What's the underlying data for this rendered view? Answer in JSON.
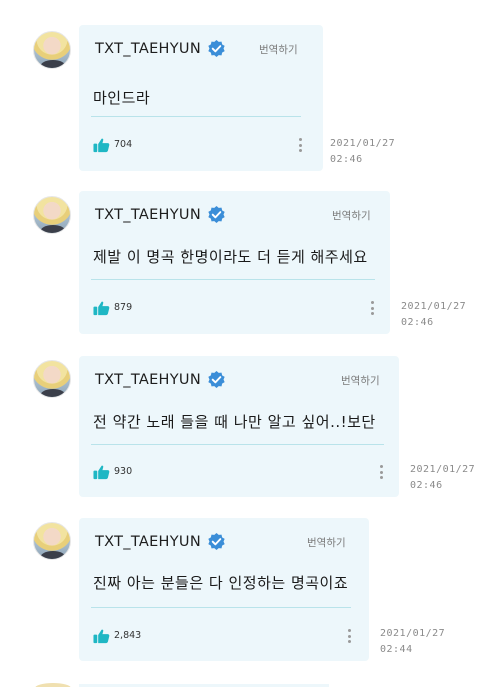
{
  "colors": {
    "bubble": "#edf7fb",
    "divider": "#b9e3ea",
    "accent": "#1fb7c4",
    "verified": "#3b8ed8"
  },
  "comments": [
    {
      "username": "TXT_TAEHYUN",
      "translate": "번역하기",
      "message": "마인드라",
      "likes": "704",
      "date": "2021/01/27",
      "time": "02:46"
    },
    {
      "username": "TXT_TAEHYUN",
      "translate": "번역하기",
      "message": "제발 이 명곡 한명이라도 더 듣게 해주세요",
      "likes": "879",
      "date": "2021/01/27",
      "time": "02:46"
    },
    {
      "username": "TXT_TAEHYUN",
      "translate": "번역하기",
      "message": "전 약간 노래 들을 때 나만 알고 싶어..!보단",
      "likes": "930",
      "date": "2021/01/27",
      "time": "02:46"
    },
    {
      "username": "TXT_TAEHYUN",
      "translate": "번역하기",
      "message": "진짜 아는 분들은 다 인정하는 명곡이죠",
      "likes": "2,843",
      "date": "2021/01/27",
      "time": "02:44"
    }
  ]
}
